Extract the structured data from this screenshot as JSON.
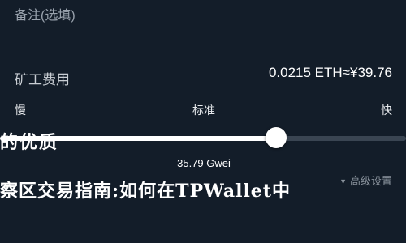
{
  "note": {
    "label": "备注(选填)"
  },
  "fee": {
    "label": "矿工费用",
    "value": "0.0215 ETH≈¥39.76"
  },
  "speed": {
    "slow_label": "慢",
    "standard_label": "标准",
    "fast_label": "快",
    "slider_fraction": 0.68,
    "gas_price": "35.79 Gwei"
  },
  "advanced": {
    "label": "高级设置",
    "icon": "caret-down-icon"
  },
  "overlay": {
    "line1": "的优质",
    "line2": "察区交易指南:如何在TPWallet中"
  },
  "colors": {
    "background": "#131d29",
    "track": "#3a4552",
    "thumb": "#ffffff"
  }
}
